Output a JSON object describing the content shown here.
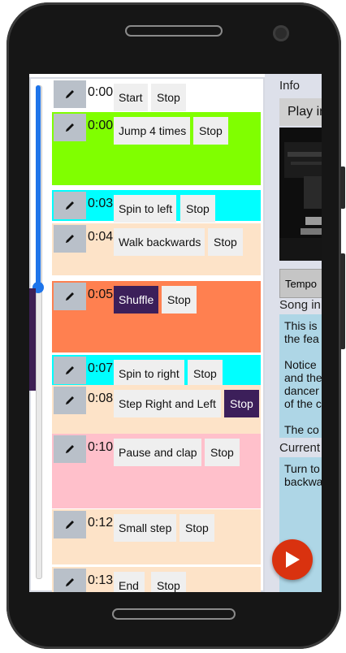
{
  "list": {
    "rows": [
      {
        "time": "0:00",
        "name": "Start",
        "stop": "Stop",
        "bg": "#ffffff",
        "stop_active": false,
        "name_active": false
      },
      {
        "time": "0:00",
        "name": "Jump 4 times",
        "stop": "Stop",
        "bg": "#80ff00",
        "stop_active": false,
        "name_active": false
      },
      {
        "time": "0:03",
        "name": "Spin to left",
        "stop": "Stop",
        "bg": "#00ffff",
        "stop_active": false,
        "name_active": false
      },
      {
        "time": "0:04",
        "name": "Walk backwards",
        "stop": "Stop",
        "bg": "#fde3c8",
        "stop_active": false,
        "name_active": false
      },
      {
        "time": "0:05",
        "name": "Shuffle",
        "stop": "Stop",
        "bg": "#ff8050",
        "stop_active": false,
        "name_active": true
      },
      {
        "time": "0:07",
        "name": "Spin to right",
        "stop": "Stop",
        "bg": "#00ffff",
        "stop_active": false,
        "name_active": false
      },
      {
        "time": "0:08",
        "name": "Step Right and Left",
        "stop": "Stop",
        "bg": "#fde3c8",
        "stop_active": true,
        "name_active": false
      },
      {
        "time": "0:10",
        "name": "Pause and clap",
        "stop": "Stop",
        "bg": "#ffc0cb",
        "stop_active": false,
        "name_active": false
      },
      {
        "time": "0:12",
        "name": "Small step",
        "stop": "Stop",
        "bg": "#fde3c8",
        "stop_active": false,
        "name_active": false
      },
      {
        "time": "0:13",
        "name": "End",
        "stop": "Stop",
        "bg": "#fde3c8",
        "stop_active": false,
        "name_active": false
      }
    ]
  },
  "info": {
    "title": "Info",
    "play_in": "Play in",
    "tempo_label": "Tempo",
    "song_info_label": "Song in",
    "song_info_lines": [
      "This is",
      "the fea",
      "",
      "Notice",
      "and the",
      "dancer",
      "of the c",
      "",
      "The co"
    ],
    "current_label": "Current",
    "current_lines": [
      "Turn to",
      "backwa"
    ]
  },
  "colors": {
    "accent": "#1e74ea",
    "active": "#3c1f5a",
    "play_button": "#d9320f"
  },
  "icons": {
    "edit": "pencil-icon",
    "play": "play-icon"
  }
}
